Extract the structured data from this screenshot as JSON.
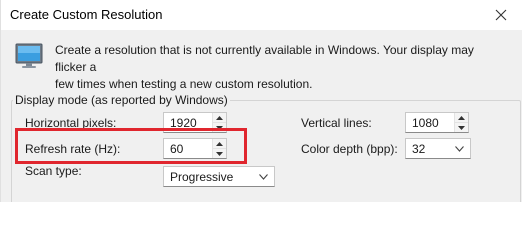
{
  "window": {
    "title": "Create Custom Resolution"
  },
  "intro": {
    "icon": "monitor-icon",
    "text_line1": "Create a resolution that is not currently available in Windows. Your display may flicker a",
    "text_line2": "few times when testing a new custom resolution."
  },
  "display_mode": {
    "legend": "Display mode (as reported by Windows)",
    "horizontal_pixels": {
      "label": "Horizontal pixels:",
      "value": "1920"
    },
    "refresh_rate": {
      "label": "Refresh rate (Hz):",
      "value": "60"
    },
    "scan_type": {
      "label": "Scan type:",
      "selected": "Progressive"
    },
    "vertical_lines": {
      "label": "Vertical lines:",
      "value": "1080"
    },
    "color_depth": {
      "label": "Color depth (bpp):",
      "selected": "32"
    }
  },
  "annotation": {
    "highlight_color": "#e0262e",
    "highlight_target": "refresh-rate-row"
  }
}
